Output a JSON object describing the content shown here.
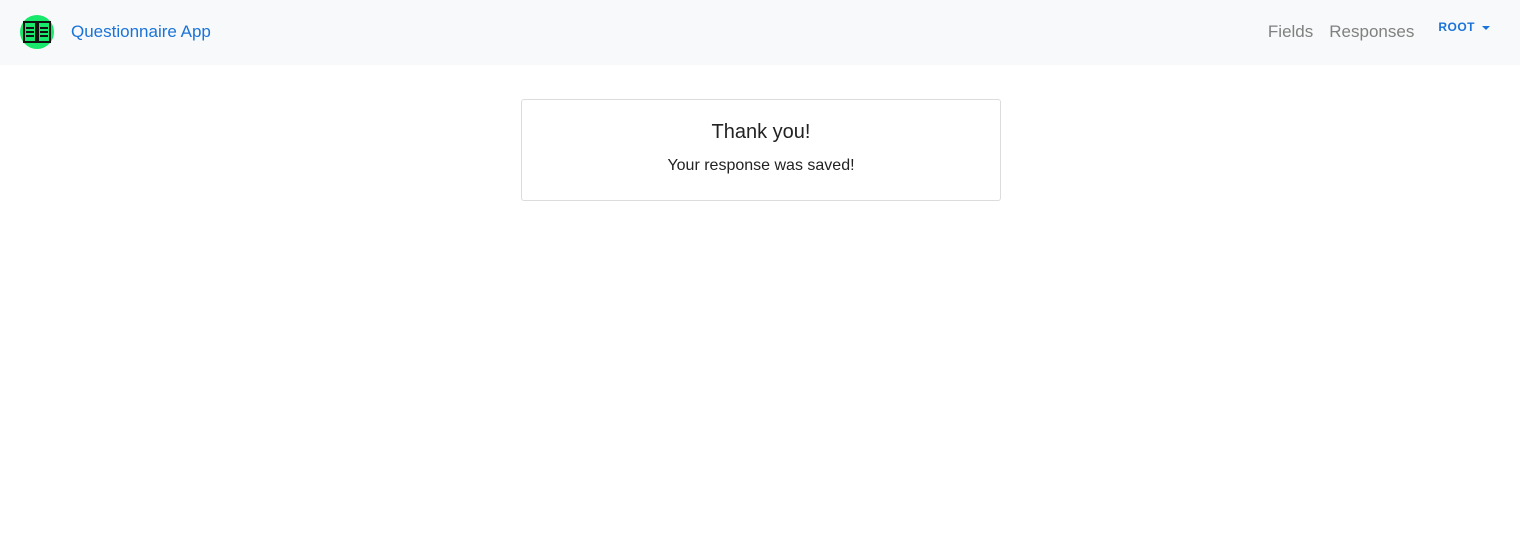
{
  "navbar": {
    "brand_label": "Questionnaire App",
    "logo_icon": "open-book-icon",
    "logo_color": "#18e86c",
    "links": [
      {
        "label": "Fields"
      },
      {
        "label": "Responses"
      }
    ],
    "user_menu": {
      "label": "ROOT",
      "icon": "caret-down-icon"
    }
  },
  "message": {
    "title": "Thank you!",
    "text": "Your response was saved!"
  },
  "colors": {
    "navbar_background": "#f8f9fa",
    "link_accent": "#1a73d9",
    "nav_link_muted": "#808080",
    "card_border": "#dcdcdc"
  }
}
